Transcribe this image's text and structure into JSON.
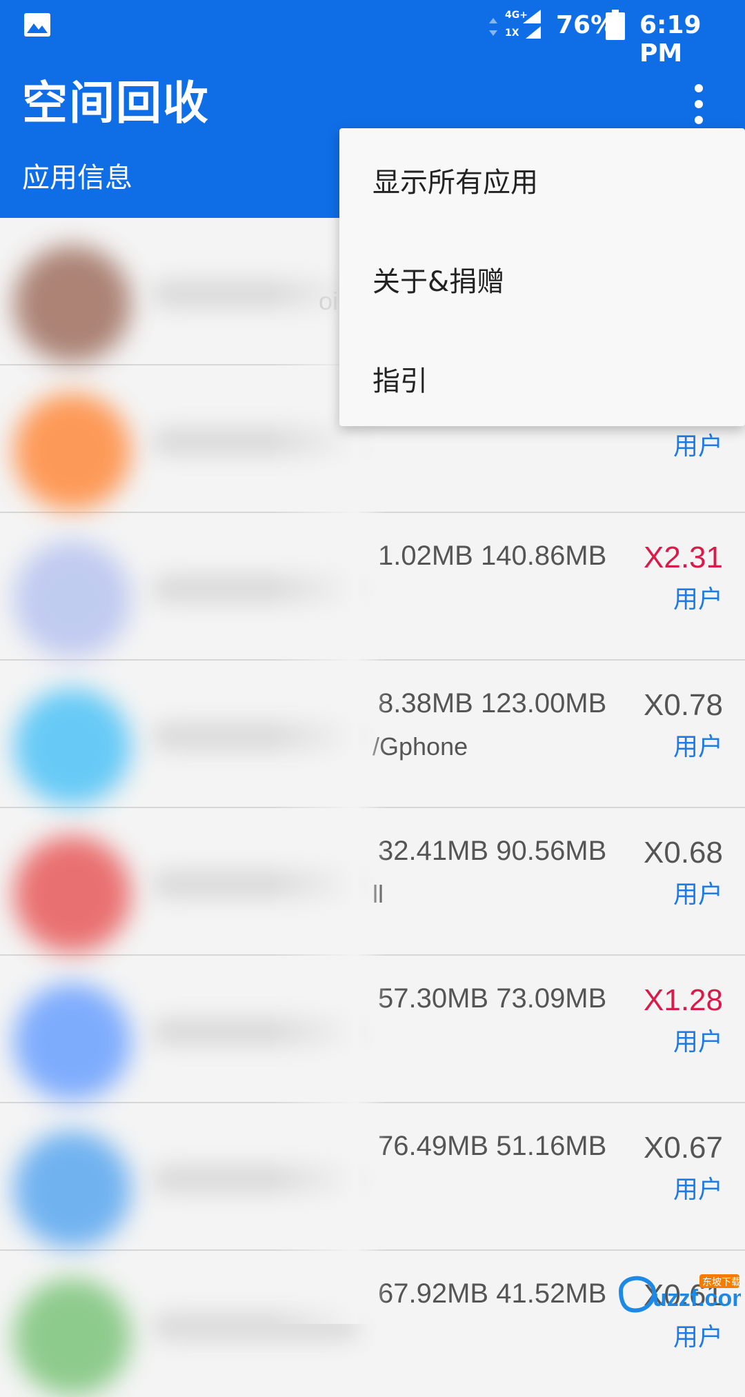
{
  "status_bar": {
    "network_top": "4G+",
    "network_bottom": "1X",
    "battery": "76%",
    "time": "6:19 PM"
  },
  "app_bar": {
    "title": "空间回收",
    "subtitle": "应用信息"
  },
  "menu": {
    "items": [
      {
        "label": "显示所有应用"
      },
      {
        "label": "关于&捐赠"
      },
      {
        "label": "指引"
      }
    ]
  },
  "rows": [
    {
      "sizes": "",
      "ratio": "",
      "package": "oi",
      "type": ""
    },
    {
      "sizes": "",
      "ratio": "",
      "package": "",
      "type": "用户"
    },
    {
      "sizes": "1.02MB  140.86MB",
      "ratio": "X2.31",
      "package": "",
      "type": "用户"
    },
    {
      "sizes": "8.38MB  123.00MB",
      "ratio": "X0.78",
      "package": "/Gphone",
      "type": "用户"
    },
    {
      "sizes": "32.41MB  90.56MB",
      "ratio": "X0.68",
      "package": "ll",
      "type": "用户"
    },
    {
      "sizes": "57.30MB  73.09MB",
      "ratio": "X1.28",
      "package": "",
      "type": "用户"
    },
    {
      "sizes": "76.49MB  51.16MB",
      "ratio": "X0.67",
      "package": "",
      "type": "用户"
    },
    {
      "sizes": "67.92MB  41.52MB",
      "ratio": "X0.61",
      "package": "",
      "type": "用户"
    }
  ],
  "colors": {
    "app_bar": "#0f6ee6",
    "ratio_high": "#d81b48",
    "ratio_normal": "#555555",
    "type_label": "#1e7be6"
  },
  "avatar_colors": [
    "#a07060",
    "#ff8a3d",
    "#b8c4f0",
    "#4fc3f7",
    "#e85a5a",
    "#6aa0ff",
    "#5aa7f0",
    "#7cc47a"
  ],
  "watermark": {
    "text": "uzzf.com",
    "tag": "东坡下载"
  }
}
